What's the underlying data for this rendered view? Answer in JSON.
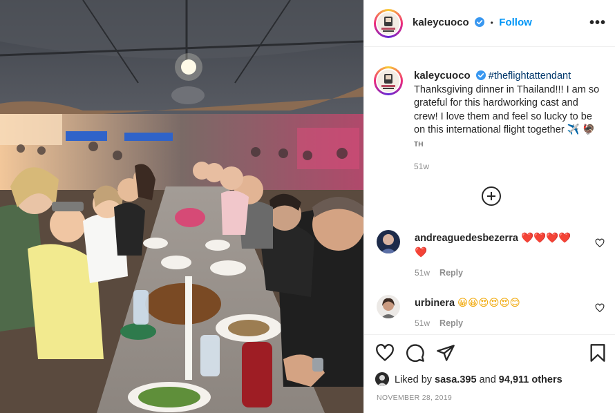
{
  "post": {
    "author": "kaleycuoco",
    "follow_label": "Follow",
    "separator": "•",
    "more_label": "•••"
  },
  "caption": {
    "username": "kaleycuoco",
    "hashtag": "#theflightattendant",
    "text": "Thanksgiving dinner in Thailand!!! I am so grateful for this hardworking cast and crew! I love them and feel so lucky to be on this international flight together",
    "emoji_suffix": "✈️ 🦃",
    "flag_text": "TH",
    "time": "51w"
  },
  "comments": [
    {
      "username": "andreaguedesbezerra",
      "text": "❤️❤️❤️❤️❤️",
      "time": "51w",
      "reply_label": "Reply"
    },
    {
      "username": "urbinera",
      "text": "😀😀😍😍😍😊",
      "time": "51w",
      "reply_label": "Reply"
    }
  ],
  "likes": {
    "prefix": "Liked by",
    "user": "sasa.395",
    "connector": "and",
    "count_text": "94,911 others"
  },
  "date": "NOVEMBER 28, 2019",
  "colors": {
    "link_blue": "#0095f6",
    "hashtag_blue": "#00376b",
    "muted_gray": "#8e8e8e",
    "text_dark": "#262626",
    "heart_red": "#ed4956"
  },
  "icons": [
    "verified-badge-icon",
    "more-options-icon",
    "load-more-comments-icon",
    "heart-icon",
    "comment-icon",
    "share-icon",
    "bookmark-icon"
  ]
}
